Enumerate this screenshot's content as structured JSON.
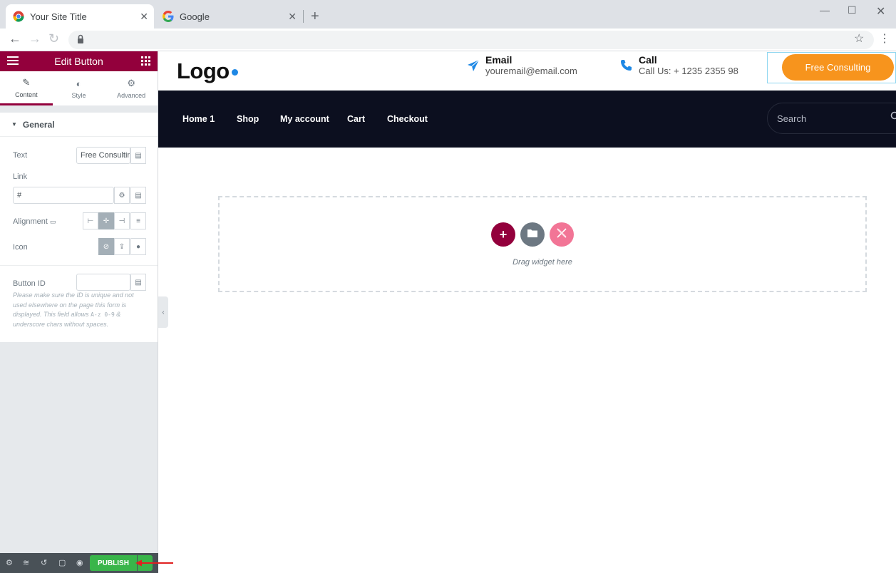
{
  "browser": {
    "tabs": [
      {
        "title": "Your Site Title"
      },
      {
        "title": "Google"
      }
    ],
    "new_tab": "+",
    "close": "✕"
  },
  "editor": {
    "panel_title": "Edit Button",
    "tabs": [
      {
        "label": "Content"
      },
      {
        "label": "Style"
      },
      {
        "label": "Advanced"
      }
    ],
    "section_title": "General",
    "text_label": "Text",
    "text_value": "Free Consulting",
    "link_label": "Link",
    "link_value": "#",
    "alignment_label": "Alignment",
    "icon_label": "Icon",
    "button_id_label": "Button ID",
    "button_id_value": "",
    "help_1": "Please make sure the ID is unique and not used elsewhere on the page this form is displayed. This field allows ",
    "help_code": "A-z 0-9",
    "help_2": " & underscore chars without spaces.",
    "publish_label": "PUBLISH"
  },
  "site": {
    "logo": "Logo",
    "email_title": "Email",
    "email_value": "youremail@email.com",
    "call_title": "Call",
    "call_value": "Call Us: + 1235 2355 98",
    "cta_label": "Free Consulting",
    "nav": [
      "Home 1",
      "Shop",
      "My account",
      "Cart",
      "Checkout"
    ],
    "search_placeholder": "Search",
    "drop_text": "Drag widget here"
  },
  "colors": {
    "editor_accent": "#93003c",
    "cta": "#f7941d",
    "nav_bg": "#0c0f1f",
    "publish": "#39b54a",
    "contact_icon": "#1e88e5"
  }
}
